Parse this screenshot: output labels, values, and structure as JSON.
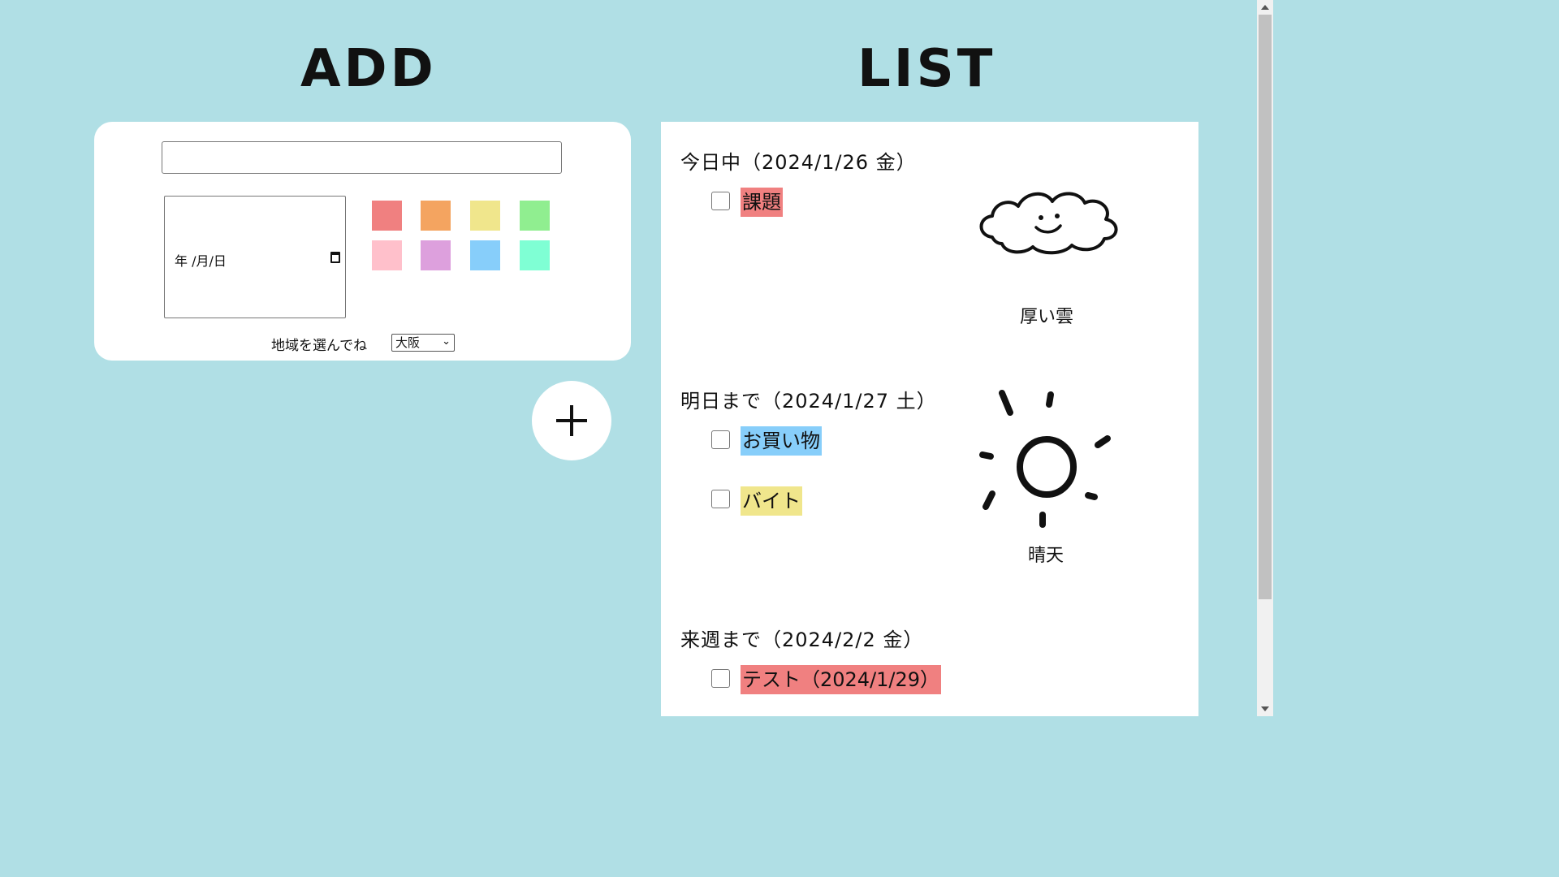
{
  "add_section": {
    "heading": "ADD",
    "title_input_value": "",
    "date_placeholder": "年 /月/日",
    "colors": [
      "#f08080",
      "#f4a460",
      "#f0e68c",
      "#90ee90",
      "#ffc0cb",
      "#dda0dd",
      "#87cefa",
      "#7fffd4"
    ],
    "region_label": "地域を選んでね",
    "region_selected": "大阪",
    "add_button_label": "+"
  },
  "list_section": {
    "heading": "LIST",
    "groups": [
      {
        "title": "今日中（2024/1/26 金）",
        "todos": [
          {
            "label": "課題",
            "color": "#f08080",
            "checked": false
          }
        ],
        "weather": {
          "icon": "cloud-icon",
          "text": "厚い雲"
        }
      },
      {
        "title": "明日まで（2024/1/27 土）",
        "todos": [
          {
            "label": "お買い物",
            "color": "#87cefa",
            "checked": false
          },
          {
            "label": "バイト",
            "color": "#f0e68c",
            "checked": false
          }
        ],
        "weather": {
          "icon": "sun-icon",
          "text": "晴天"
        }
      },
      {
        "title": "来週まで（2024/2/2 金）",
        "todos": [
          {
            "label": "テスト（2024/1/29）",
            "color": "#f08080",
            "checked": false
          }
        ]
      }
    ]
  }
}
